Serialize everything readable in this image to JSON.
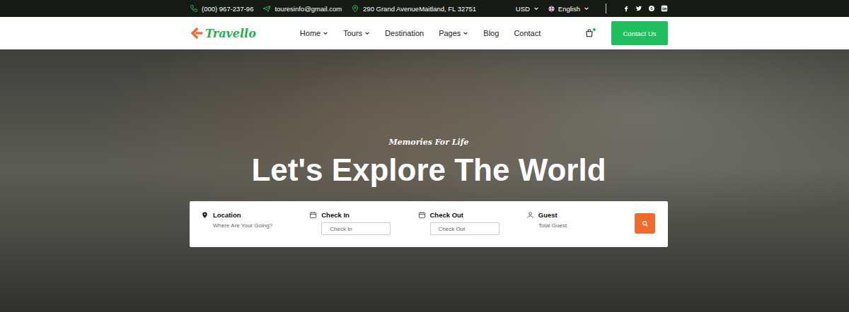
{
  "topbar": {
    "phone": "(000) 967-237-96",
    "email": "touresinfo@gmail.com",
    "address": "290 Grand AvenueMaitland, FL 32751",
    "currency": "USD",
    "language": "English"
  },
  "nav": {
    "logo": "Travello",
    "items": [
      {
        "label": "Home",
        "dropdown": true
      },
      {
        "label": "Tours",
        "dropdown": true
      },
      {
        "label": "Destination",
        "dropdown": false
      },
      {
        "label": "Pages",
        "dropdown": true
      },
      {
        "label": "Blog",
        "dropdown": false
      },
      {
        "label": "Contact",
        "dropdown": false
      }
    ],
    "cta": "Contact Us"
  },
  "hero": {
    "tagline": "Memories For Life",
    "title": "Let's Explore The World"
  },
  "search": {
    "fields": [
      {
        "kind": "location",
        "label": "Location",
        "hint": "Where Are Your Going?"
      },
      {
        "kind": "date",
        "label": "Check In",
        "hint": "Check In"
      },
      {
        "kind": "date",
        "label": "Check Out",
        "hint": "Check Out"
      },
      {
        "kind": "guest",
        "label": "Guest",
        "hint": "Total Guest"
      }
    ]
  }
}
